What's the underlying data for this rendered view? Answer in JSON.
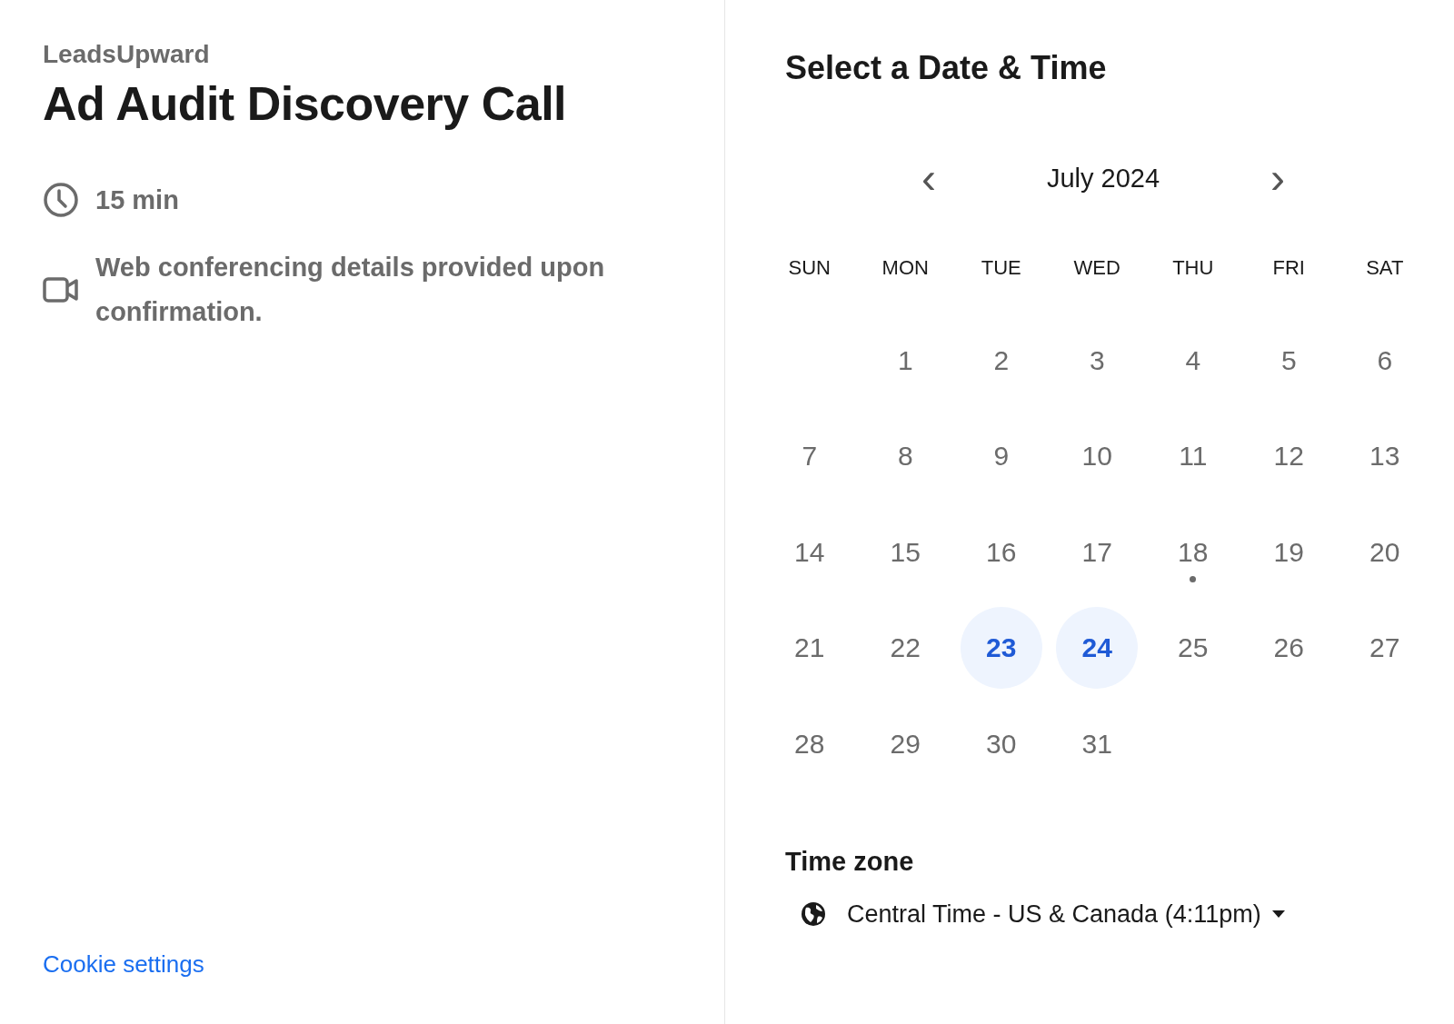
{
  "event": {
    "organizer": "LeadsUpward",
    "title": "Ad Audit Discovery Call",
    "duration": "15 min",
    "location": "Web conferencing details provided upon confirmation."
  },
  "cookie_link": "Cookie settings",
  "picker": {
    "title": "Select a Date & Time",
    "month": "July 2024",
    "prev": "‹",
    "next": "›",
    "weekdays": [
      "SUN",
      "MON",
      "TUE",
      "WED",
      "THU",
      "FRI",
      "SAT"
    ],
    "weeks": [
      [
        {
          "kind": "blank"
        },
        {
          "kind": "day",
          "label": "1",
          "available": false,
          "today": false
        },
        {
          "kind": "day",
          "label": "2",
          "available": false,
          "today": false
        },
        {
          "kind": "day",
          "label": "3",
          "available": false,
          "today": false
        },
        {
          "kind": "day",
          "label": "4",
          "available": false,
          "today": false
        },
        {
          "kind": "day",
          "label": "5",
          "available": false,
          "today": false
        },
        {
          "kind": "day",
          "label": "6",
          "available": false,
          "today": false
        }
      ],
      [
        {
          "kind": "day",
          "label": "7",
          "available": false,
          "today": false
        },
        {
          "kind": "day",
          "label": "8",
          "available": false,
          "today": false
        },
        {
          "kind": "day",
          "label": "9",
          "available": false,
          "today": false
        },
        {
          "kind": "day",
          "label": "10",
          "available": false,
          "today": false
        },
        {
          "kind": "day",
          "label": "11",
          "available": false,
          "today": false
        },
        {
          "kind": "day",
          "label": "12",
          "available": false,
          "today": false
        },
        {
          "kind": "day",
          "label": "13",
          "available": false,
          "today": false
        }
      ],
      [
        {
          "kind": "day",
          "label": "14",
          "available": false,
          "today": false
        },
        {
          "kind": "day",
          "label": "15",
          "available": false,
          "today": false
        },
        {
          "kind": "day",
          "label": "16",
          "available": false,
          "today": false
        },
        {
          "kind": "day",
          "label": "17",
          "available": false,
          "today": false
        },
        {
          "kind": "day",
          "label": "18",
          "available": false,
          "today": true
        },
        {
          "kind": "day",
          "label": "19",
          "available": false,
          "today": false
        },
        {
          "kind": "day",
          "label": "20",
          "available": false,
          "today": false
        }
      ],
      [
        {
          "kind": "day",
          "label": "21",
          "available": false,
          "today": false
        },
        {
          "kind": "day",
          "label": "22",
          "available": false,
          "today": false
        },
        {
          "kind": "day",
          "label": "23",
          "available": true,
          "today": false
        },
        {
          "kind": "day",
          "label": "24",
          "available": true,
          "today": false
        },
        {
          "kind": "day",
          "label": "25",
          "available": false,
          "today": false
        },
        {
          "kind": "day",
          "label": "26",
          "available": false,
          "today": false
        },
        {
          "kind": "day",
          "label": "27",
          "available": false,
          "today": false
        }
      ],
      [
        {
          "kind": "day",
          "label": "28",
          "available": false,
          "today": false
        },
        {
          "kind": "day",
          "label": "29",
          "available": false,
          "today": false
        },
        {
          "kind": "day",
          "label": "30",
          "available": false,
          "today": false
        },
        {
          "kind": "day",
          "label": "31",
          "available": false,
          "today": false
        }
      ]
    ],
    "timezone_label": "Time zone",
    "timezone": "Central Time - US & Canada (4:11pm)"
  }
}
